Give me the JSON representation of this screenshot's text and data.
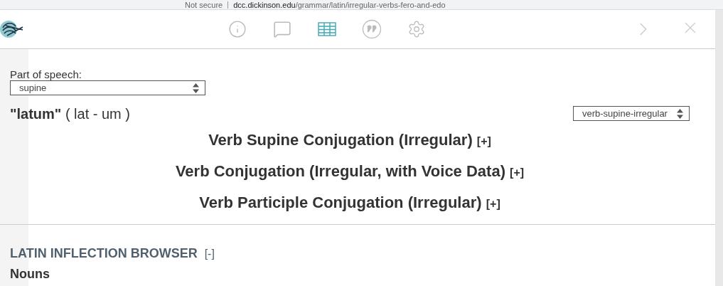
{
  "browser": {
    "security": "Not secure",
    "url_host": "dcc.dickinson.edu",
    "url_path": "/grammar/latin/irregular-verbs-fero-and-edo"
  },
  "toolbar": {
    "tabs": [
      {
        "kind": "info",
        "selected": false
      },
      {
        "kind": "comment",
        "selected": false
      },
      {
        "kind": "table",
        "selected": true
      },
      {
        "kind": "quote",
        "selected": false
      },
      {
        "kind": "settings",
        "selected": false
      }
    ],
    "buttons": [
      {
        "kind": "next"
      },
      {
        "kind": "close"
      }
    ]
  },
  "part_of_speech": {
    "label": "Part of speech:",
    "value": "supine"
  },
  "word": {
    "form": "\"latum\"",
    "syllables": "( lat - um )"
  },
  "table_select": {
    "value": "verb-supine-irregular"
  },
  "tables": [
    {
      "title": "Verb Supine Conjugation (Irregular)",
      "toggle": "[+]"
    },
    {
      "title": "Verb Conjugation (Irregular, with Voice Data)",
      "toggle": "[+]"
    },
    {
      "title": "Verb Participle Conjugation (Irregular)",
      "toggle": "[+]"
    }
  ],
  "browser_section": {
    "title": "LATIN INFLECTION BROWSER",
    "toggle": "[-]",
    "subheading": "Nouns"
  }
}
